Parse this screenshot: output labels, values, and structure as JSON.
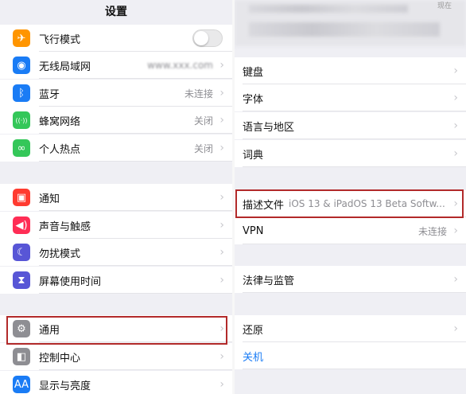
{
  "left": {
    "title": "设置",
    "groups": [
      [
        {
          "label": "飞行模式",
          "icon": "airplane-icon",
          "color": "#ff9500",
          "glyph": "✈",
          "toggle": false
        },
        {
          "label": "无线局域网",
          "icon": "wifi-icon",
          "color": "#1a7cf5",
          "glyph": "◉",
          "value": "www.xxx.com"
        },
        {
          "label": "蓝牙",
          "icon": "bluetooth-icon",
          "color": "#1a7cf5",
          "glyph": "ᛒ",
          "value": "未连接"
        },
        {
          "label": "蜂窝网络",
          "icon": "cellular-icon",
          "color": "#34c759",
          "glyph": "((·))",
          "value": "关闭"
        },
        {
          "label": "个人热点",
          "icon": "hotspot-icon",
          "color": "#34c759",
          "glyph": "∞",
          "value": "关闭"
        }
      ],
      [
        {
          "label": "通知",
          "icon": "notification-icon",
          "color": "#ff3b30",
          "glyph": "▣"
        },
        {
          "label": "声音与触感",
          "icon": "sound-icon",
          "color": "#ff2d55",
          "glyph": "◀)"
        },
        {
          "label": "勿扰模式",
          "icon": "moon-icon",
          "color": "#5856d6",
          "glyph": "☾"
        },
        {
          "label": "屏幕使用时间",
          "icon": "hourglass-icon",
          "color": "#5856d6",
          "glyph": "⧗"
        }
      ],
      [
        {
          "label": "通用",
          "icon": "gear-icon",
          "color": "#8e8e93",
          "glyph": "⚙"
        },
        {
          "label": "控制中心",
          "icon": "control-center-icon",
          "color": "#8e8e93",
          "glyph": "◧"
        },
        {
          "label": "显示与亮度",
          "icon": "display-icon",
          "color": "#1a7cf5",
          "glyph": "AA"
        }
      ]
    ]
  },
  "right": {
    "header_status": "现在",
    "groups": [
      [
        {
          "label": "键盘"
        },
        {
          "label": "字体"
        },
        {
          "label": "语言与地区"
        },
        {
          "label": "词典"
        }
      ],
      [
        {
          "label": "描述文件",
          "value": "iOS 13 & iPadOS 13 Beta Softw..."
        },
        {
          "label": "VPN",
          "value": "未连接"
        }
      ],
      [
        {
          "label": "法律与监管"
        }
      ],
      [
        {
          "label": "还原"
        },
        {
          "label": "关机",
          "color": "#1a7cf5",
          "no_chevron": true
        }
      ]
    ]
  },
  "chevron": "›",
  "colors": {
    "highlight": "#b22a2a",
    "background": "#efeff4",
    "accent": "#1a7cf5"
  }
}
